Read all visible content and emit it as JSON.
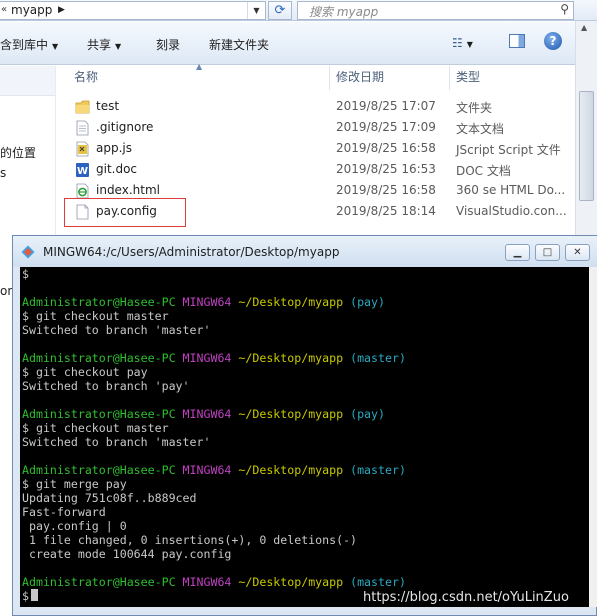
{
  "explorer": {
    "address": {
      "path": "myapp"
    },
    "search": {
      "placeholder": "搜索 myapp"
    },
    "toolbar": {
      "items": [
        {
          "label": "含到库中"
        },
        {
          "label": "共享"
        },
        {
          "label": "刻录"
        },
        {
          "label": "新建文件夹"
        }
      ]
    },
    "nav": {
      "labels": [
        "的位置",
        "s",
        "on"
      ]
    },
    "columns": {
      "name": "名称",
      "date": "修改日期",
      "type": "类型"
    },
    "files": [
      {
        "name": "test",
        "date": "2019/8/25 17:07",
        "type": "文件夹",
        "icon": "folder-icon"
      },
      {
        "name": ".gitignore",
        "date": "2019/8/25 17:09",
        "type": "文本文档",
        "icon": "text-file-icon"
      },
      {
        "name": "app.js",
        "date": "2019/8/25 16:58",
        "type": "JScript Script 文件",
        "icon": "jscript-file-icon"
      },
      {
        "name": "git.doc",
        "date": "2019/8/25 16:53",
        "type": "DOC 文档",
        "icon": "word-doc-icon"
      },
      {
        "name": "index.html",
        "date": "2019/8/25 16:58",
        "type": "360 se HTML Do...",
        "icon": "html-file-icon"
      },
      {
        "name": "pay.config",
        "date": "2019/8/25 18:14",
        "type": "VisualStudio.con...",
        "icon": "config-file-icon",
        "highlighted": true
      }
    ]
  },
  "terminal": {
    "title": "MINGW64:/c/Users/Administrator/Desktop/myapp",
    "first_line": "$",
    "blocks": [
      {
        "user": "Administrator@Hasee-PC",
        "shell": "MINGW64",
        "path": "~/Desktop/myapp",
        "branch": "(pay)",
        "command": "$ git checkout master",
        "output": [
          "Switched to branch 'master'"
        ]
      },
      {
        "user": "Administrator@Hasee-PC",
        "shell": "MINGW64",
        "path": "~/Desktop/myapp",
        "branch": "(master)",
        "command": "$ git checkout pay",
        "output": [
          "Switched to branch 'pay'"
        ]
      },
      {
        "user": "Administrator@Hasee-PC",
        "shell": "MINGW64",
        "path": "~/Desktop/myapp",
        "branch": "(pay)",
        "command": "$ git checkout master",
        "output": [
          "Switched to branch 'master'"
        ]
      },
      {
        "user": "Administrator@Hasee-PC",
        "shell": "MINGW64",
        "path": "~/Desktop/myapp",
        "branch": "(master)",
        "command": "$ git merge pay",
        "output": [
          "Updating 751c08f..b889ced",
          "Fast-forward",
          " pay.config | 0",
          " 1 file changed, 0 insertions(+), 0 deletions(-)",
          " create mode 100644 pay.config"
        ]
      },
      {
        "user": "Administrator@Hasee-PC",
        "shell": "MINGW64",
        "path": "~/Desktop/myapp",
        "branch": "(master)",
        "command": "$",
        "output": []
      }
    ]
  },
  "watermark": "https://blog.csdn.net/oYuLinZuo",
  "colors": {
    "user": "#2fbe2f",
    "host": "#c040c0",
    "path": "#c8c800",
    "branch": "#2aa8c0",
    "highlight": "#e03a3a"
  }
}
